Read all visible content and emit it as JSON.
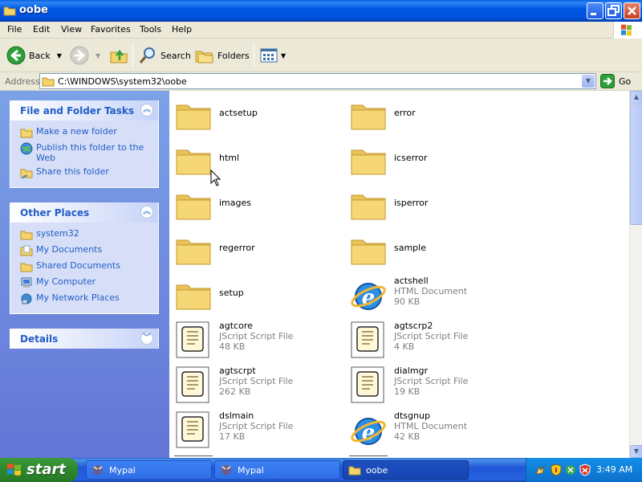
{
  "window": {
    "title": "oobe"
  },
  "menu": [
    "File",
    "Edit",
    "View",
    "Favorites",
    "Tools",
    "Help"
  ],
  "toolbar": {
    "back": "Back",
    "search": "Search",
    "folders": "Folders"
  },
  "address": {
    "label": "Address",
    "path": "C:\\WINDOWS\\system32\\oobe",
    "go": "Go"
  },
  "tasks": {
    "title": "File and Folder Tasks",
    "items": [
      "Make a new folder",
      "Publish this folder to the Web",
      "Share this folder"
    ]
  },
  "places": {
    "title": "Other Places",
    "items": [
      "system32",
      "My Documents",
      "Shared Documents",
      "My Computer",
      "My Network Places"
    ]
  },
  "details": {
    "title": "Details"
  },
  "files": [
    {
      "name": "actsetup",
      "type": "",
      "size": "",
      "icon": "folder-icon"
    },
    {
      "name": "error",
      "type": "",
      "size": "",
      "icon": "folder-icon"
    },
    {
      "name": "html",
      "type": "",
      "size": "",
      "icon": "folder-icon"
    },
    {
      "name": "icserror",
      "type": "",
      "size": "",
      "icon": "folder-icon"
    },
    {
      "name": "images",
      "type": "",
      "size": "",
      "icon": "folder-icon"
    },
    {
      "name": "isperror",
      "type": "",
      "size": "",
      "icon": "folder-icon"
    },
    {
      "name": "regerror",
      "type": "",
      "size": "",
      "icon": "folder-icon"
    },
    {
      "name": "sample",
      "type": "",
      "size": "",
      "icon": "folder-icon"
    },
    {
      "name": "setup",
      "type": "",
      "size": "",
      "icon": "folder-icon"
    },
    {
      "name": "actshell",
      "type": "HTML Document",
      "size": "90 KB",
      "icon": "ie-document-icon"
    },
    {
      "name": "agtcore",
      "type": "JScript Script File",
      "size": "48 KB",
      "icon": "script-file-icon"
    },
    {
      "name": "agtscrp2",
      "type": "JScript Script File",
      "size": "4 KB",
      "icon": "script-file-icon"
    },
    {
      "name": "agtscrpt",
      "type": "JScript Script File",
      "size": "262 KB",
      "icon": "script-file-icon"
    },
    {
      "name": "dialmgr",
      "type": "JScript Script File",
      "size": "19 KB",
      "icon": "script-file-icon"
    },
    {
      "name": "dslmain",
      "type": "JScript Script File",
      "size": "17 KB",
      "icon": "script-file-icon"
    },
    {
      "name": "dtsgnup",
      "type": "HTML Document",
      "size": "42 KB",
      "icon": "ie-document-icon"
    }
  ],
  "taskbar": {
    "start": "start",
    "buttons": [
      {
        "label": "Mypal",
        "active": false
      },
      {
        "label": "Mypal",
        "active": false
      },
      {
        "label": "oobe",
        "active": true
      }
    ],
    "clock": "3:49 AM"
  }
}
